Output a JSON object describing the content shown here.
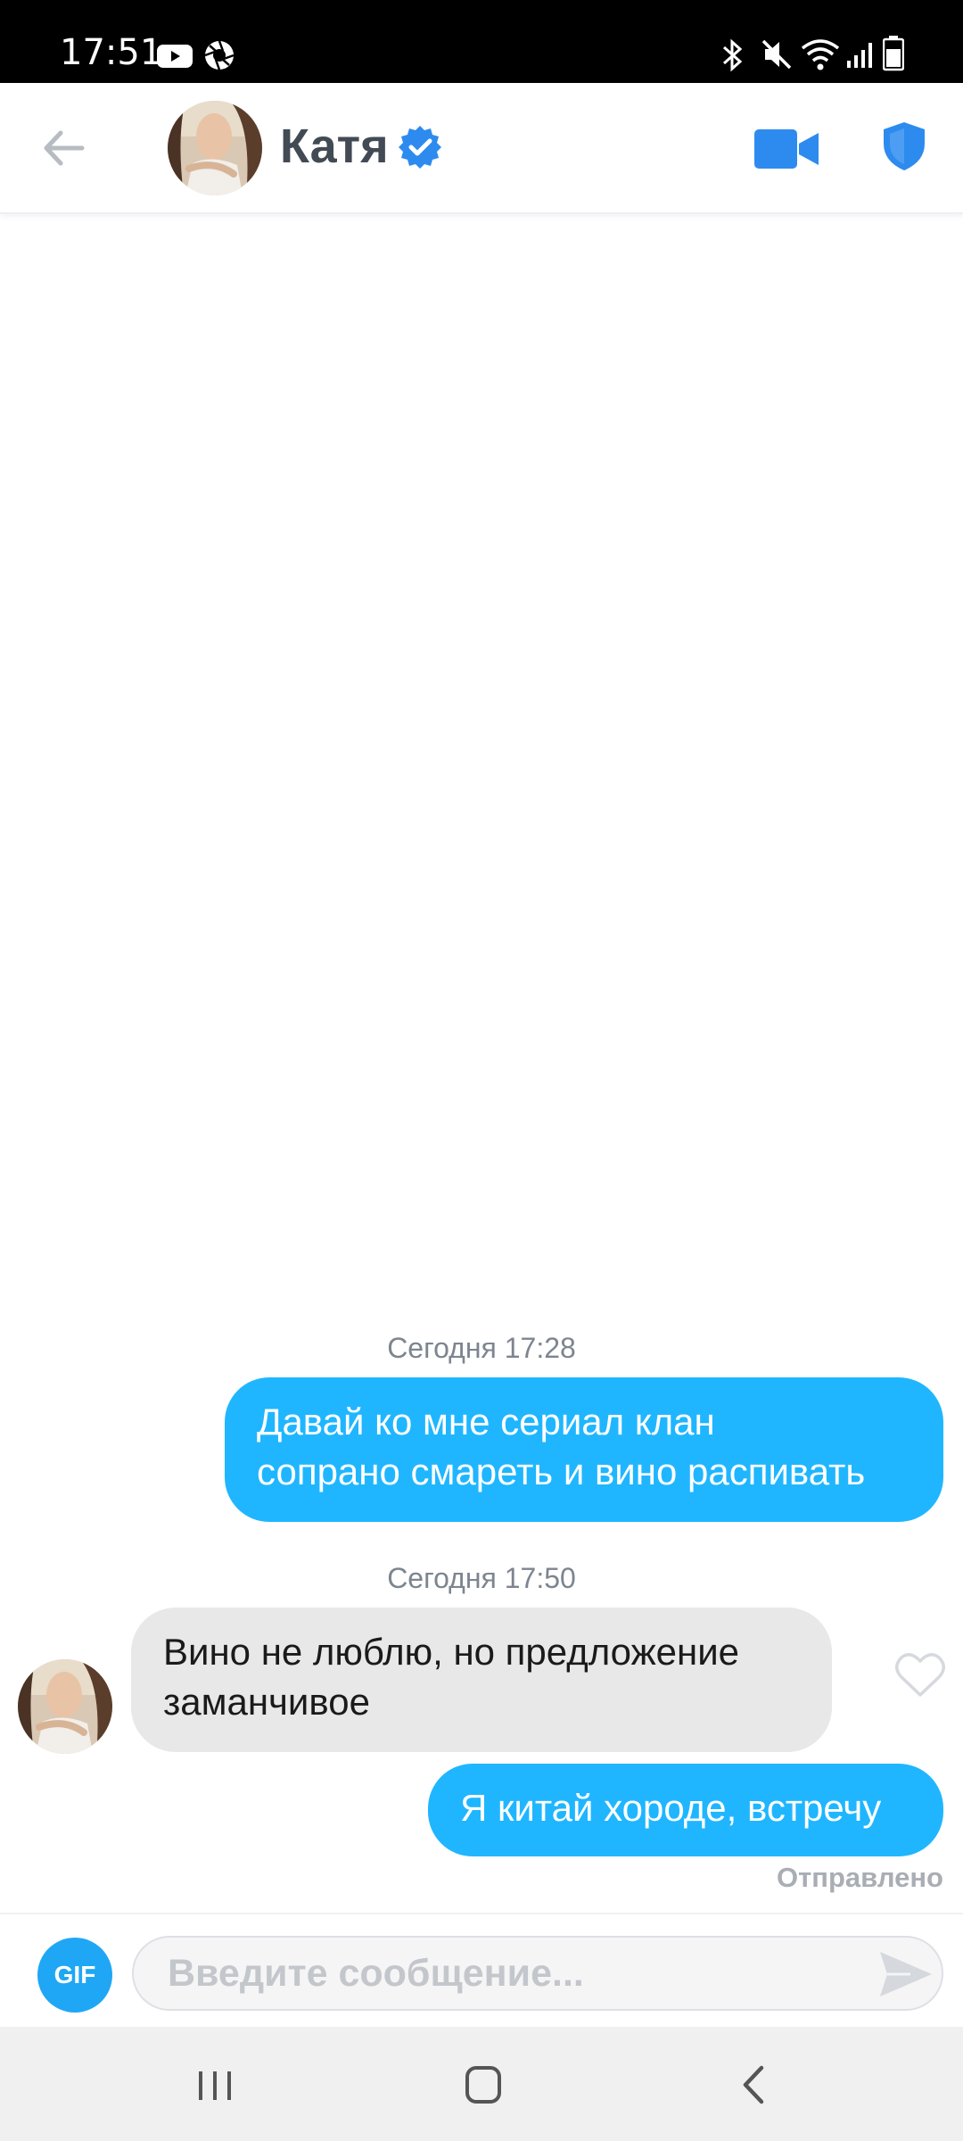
{
  "status_bar": {
    "time": "17:51",
    "icons": [
      "youtube-icon",
      "camera-aperture-icon",
      "bluetooth-icon",
      "mute-icon",
      "wifi-icon",
      "signal-icon",
      "battery-icon"
    ]
  },
  "header": {
    "contact_name": "Катя",
    "verified": true,
    "icons": [
      "back-arrow-icon",
      "video-camera-icon",
      "shield-icon",
      "verified-badge-icon"
    ]
  },
  "conversation": {
    "groups": [
      {
        "timestamp": "Сегодня 17:28",
        "messages": [
          {
            "direction": "outgoing",
            "lines": [
              "Давай ко мне сериал клан",
              "сопрано смареть и вино распивать"
            ]
          }
        ]
      },
      {
        "timestamp": "Сегодня 17:50",
        "messages": [
          {
            "direction": "incoming",
            "lines": [
              "Вино не люблю, но предложение",
              "заманчивое"
            ]
          },
          {
            "direction": "outgoing",
            "lines": [
              "Я китай хороде, встречу"
            ],
            "status": "Отправлено"
          }
        ]
      }
    ]
  },
  "composer": {
    "gif_label": "GIF",
    "placeholder": "Введите сообщение...",
    "value": ""
  },
  "navigation_bar": {
    "icons": [
      "recent-apps-icon",
      "home-icon",
      "back-icon"
    ]
  },
  "colors": {
    "accent": "#1fb6ff",
    "header_icons": "#2d8bef",
    "incoming_bubble": "#e8e8e8",
    "status_text": "#a9aeb4"
  }
}
